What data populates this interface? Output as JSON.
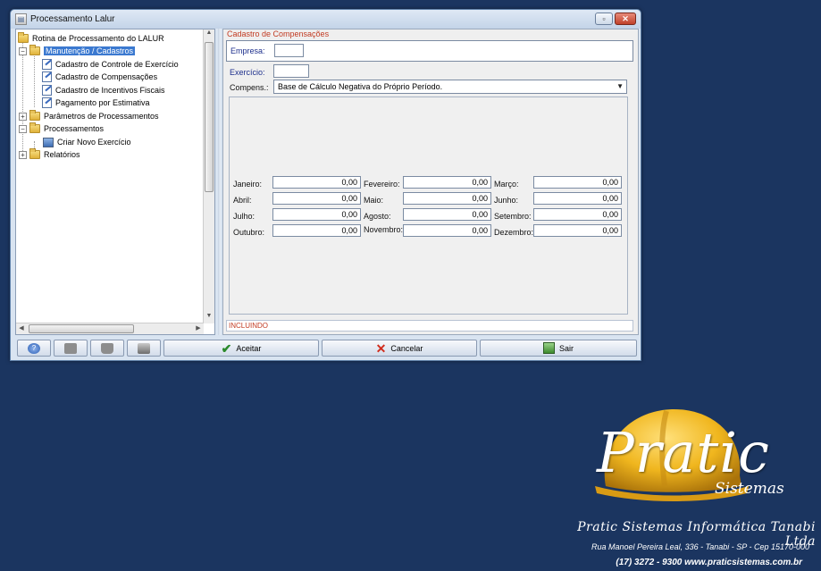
{
  "window": {
    "title": "Processamento Lalur",
    "minimize": "▫",
    "close": "✕"
  },
  "tree": {
    "root": "Rotina de Processamento do LALUR",
    "groups": [
      {
        "label": "Manutenção / Cadastros",
        "expanded": true,
        "selected": true,
        "children": [
          "Cadastro de Controle de Exercício",
          "Cadastro de Compensações",
          "Cadastro de Incentivos Fiscais",
          "Pagamento por Estimativa"
        ]
      },
      {
        "label": "Parâmetros de Processamentos",
        "expanded": false
      },
      {
        "label": "Processamentos",
        "expanded": true,
        "children": [
          "Criar Novo Exercício"
        ]
      },
      {
        "label": "Relatórios",
        "expanded": false
      }
    ]
  },
  "form": {
    "section_title": "Cadastro de Compensações",
    "empresa_label": "Empresa:",
    "empresa_value": "",
    "exercicio_label": "Exercício:",
    "exercicio_value": "",
    "compens_label": "Compens.:",
    "compens_value": "Base de Cálculo Negativa do Próprio Período.",
    "months": [
      {
        "label": "Janeiro:",
        "value": "0,00"
      },
      {
        "label": "Fevereiro:",
        "value": "0,00"
      },
      {
        "label": "Março:",
        "value": "0,00"
      },
      {
        "label": "Abril:",
        "value": "0,00"
      },
      {
        "label": "Maio:",
        "value": "0,00"
      },
      {
        "label": "Junho:",
        "value": "0,00"
      },
      {
        "label": "Julho:",
        "value": "0,00"
      },
      {
        "label": "Agosto:",
        "value": "0,00"
      },
      {
        "label": "Setembro:",
        "value": "0,00"
      },
      {
        "label": "Outubro:",
        "value": "0,00"
      },
      {
        "label": "Novembro:",
        "value": "0,00"
      },
      {
        "label": "Dezembro:",
        "value": "0,00"
      }
    ],
    "status": "INCLUINDO"
  },
  "toolbar": {
    "aceitar": "Aceitar",
    "cancelar": "Cancelar",
    "sair": "Sair",
    "help_icon": "help-icon",
    "colors": {
      "accept": "#2b8a2b",
      "cancel": "#d12c1c"
    }
  },
  "branding": {
    "logo": "Pratic",
    "logo_sub": "Sistemas",
    "company": "Pratic Sistemas Informática Tanabi Ltda",
    "address": "Rua Manoel Pereira Leal, 336 - Tanabi - SP - Cep 15170-000",
    "contact": "(17) 3272 - 9300  www.praticsistemas.com.br"
  },
  "colors": {
    "desktop_bg": "#1b3560",
    "selection": "#3b79d0",
    "section_title": "#c23b22",
    "label_blue": "#1d2f8c"
  }
}
